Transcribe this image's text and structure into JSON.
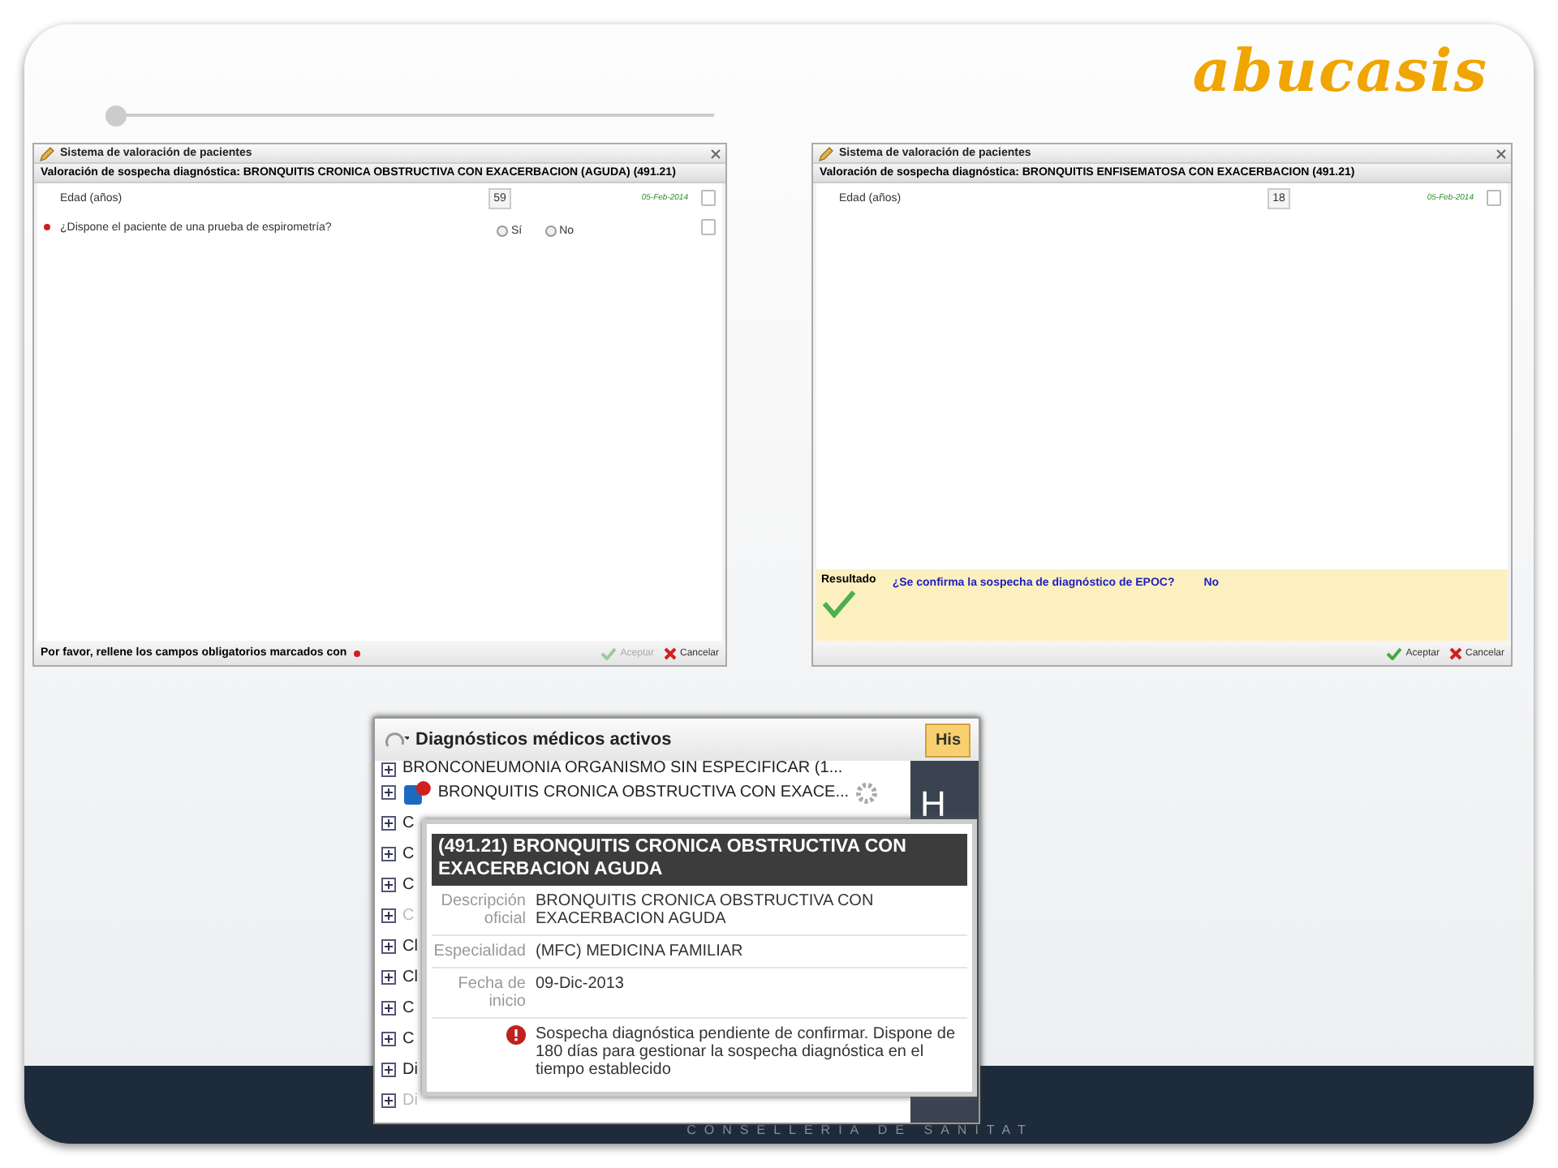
{
  "logo": "abucasis",
  "dialogs": [
    {
      "title": "Sistema de valoración de pacientes",
      "heading": "Valoración de sospecha diagnóstica: BRONQUITIS CRONICA OBSTRUCTIVA CON EXACERBACION (AGUDA) (491.21)",
      "fields": [
        {
          "kind": "number",
          "label": "Edad (años)",
          "required": false,
          "value": "59",
          "date": "05-Feb-2014",
          "checked": false
        },
        {
          "kind": "radio",
          "label": "¿Dispone el paciente de una prueba de espirometría?",
          "required": true,
          "options": [
            {
              "label": "Sí",
              "selected": false
            },
            {
              "label": "No",
              "selected": false
            }
          ],
          "checked": false
        }
      ],
      "footer_note": "Por favor, rellene los campos obligatorios marcados con",
      "buttons": [
        {
          "kind": "accept",
          "label": "Aceptar",
          "disabled": true
        },
        {
          "kind": "cancel",
          "label": "Cancelar",
          "disabled": false
        }
      ]
    },
    {
      "title": "Sistema de valoración de pacientes",
      "heading": "Valoración de sospecha diagnóstica: BRONQUITIS ENFISEMATOSA CON EXACERBACION (491.21)",
      "fields": [
        {
          "kind": "number",
          "label": "Edad (años)",
          "required": false,
          "value": "18",
          "date": "05-Feb-2014",
          "checked": false
        }
      ],
      "result": {
        "label": "Resultado",
        "question": "¿Se confirma la sospecha de diagnóstico de EPOC?",
        "answer": "No"
      },
      "buttons": [
        {
          "kind": "accept",
          "label": "Aceptar",
          "disabled": false
        },
        {
          "kind": "cancel",
          "label": "Cancelar",
          "disabled": false
        }
      ]
    }
  ],
  "panel": {
    "title": "Diagnósticos médicos activos",
    "tab": "His",
    "side_letter": "H",
    "items": [
      {
        "label": "BRONCONEUMONIA ORGANISMO SIN ESPECIFICAR (1...",
        "disabled": false,
        "alert": false
      },
      {
        "label": "BRONQUITIS CRONICA OBSTRUCTIVA CON EXACE...",
        "disabled": false,
        "alert": true
      },
      {
        "label": "C",
        "disabled": false,
        "alert": false
      },
      {
        "label": "C",
        "disabled": false,
        "alert": false
      },
      {
        "label": "C",
        "disabled": false,
        "alert": false
      },
      {
        "label": "C",
        "disabled": true,
        "alert": false
      },
      {
        "label": "Cl",
        "disabled": false,
        "alert": false
      },
      {
        "label": "Cl",
        "disabled": false,
        "alert": false
      },
      {
        "label": "C",
        "disabled": false,
        "alert": false
      },
      {
        "label": "C",
        "disabled": false,
        "alert": false
      },
      {
        "label": "Di",
        "disabled": false,
        "alert": false
      },
      {
        "label": "Di",
        "disabled": true,
        "alert": false
      }
    ],
    "tooltip": {
      "title": "(491.21) BRONQUITIS CRONICA OBSTRUCTIVA CON EXACERBACION AGUDA",
      "rows": [
        {
          "label": "Descripción oficial",
          "value": "BRONQUITIS CRONICA OBSTRUCTIVA CON EXACERBACION AGUDA"
        },
        {
          "label": "Especialidad",
          "value": "(MFC) MEDICINA FAMILIAR"
        },
        {
          "label": "Fecha de inicio",
          "value": "09-Dic-2013"
        }
      ],
      "warning": "Sospecha diagnóstica pendiente de confirmar. Dispone de 180 días para gestionar la sospecha diagnóstica en el tiempo establecido"
    }
  },
  "footer_band": "CONSELLERIA DE SANITAT"
}
